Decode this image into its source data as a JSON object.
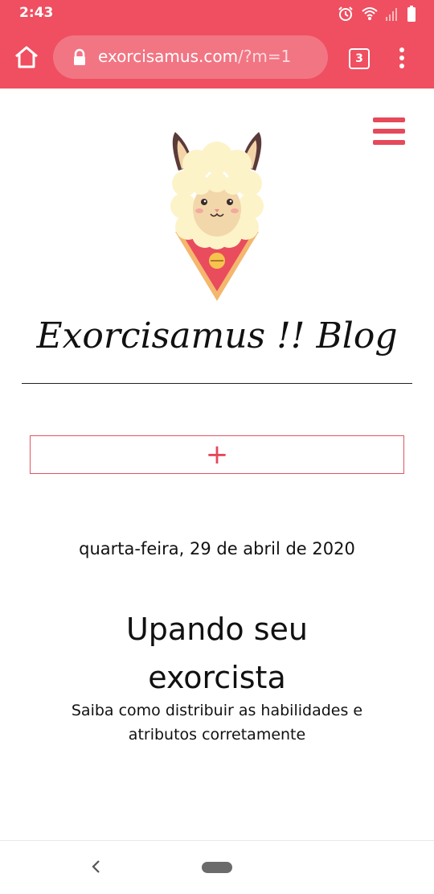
{
  "status_bar": {
    "time": "2:43"
  },
  "browser": {
    "url_domain": "exorcisamus.com",
    "url_path": "/?m=1",
    "tab_count": "3"
  },
  "blog": {
    "title": "Exorcisamus !! Blog",
    "expand_label": "+"
  },
  "post": {
    "date": "quarta-feira, 29 de abril de 2020",
    "title": "Upando seu exorcista",
    "subtitle": "Saiba como distribuir as habilidades e atributos corretamente"
  },
  "colors": {
    "accent": "#ef4f60",
    "menu": "#e5495a"
  },
  "icons": [
    "alarm-icon",
    "wifi-icon",
    "signal-icon",
    "battery-icon",
    "home-icon",
    "lock-icon",
    "tabs-icon",
    "more-vert-icon",
    "hamburger-icon",
    "back-icon",
    "home-pill-icon"
  ]
}
